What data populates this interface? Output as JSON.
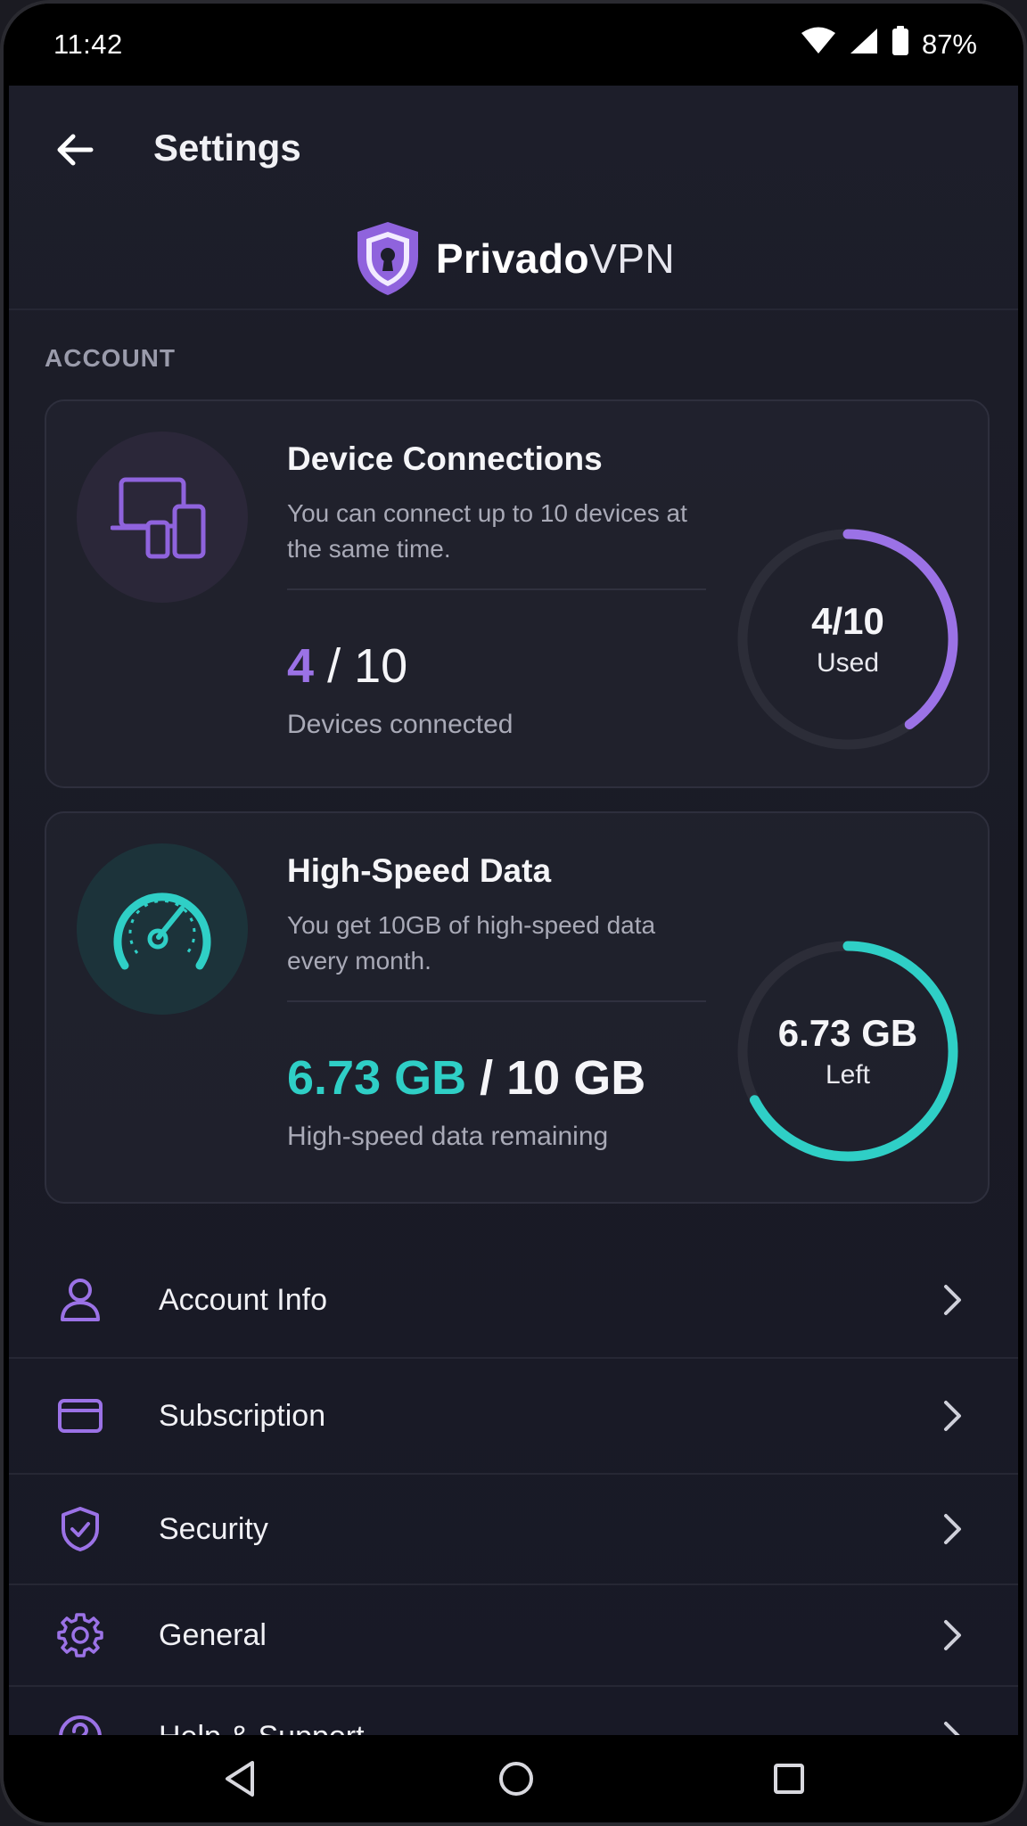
{
  "status_bar": {
    "time": "11:42",
    "battery": "87%"
  },
  "header": {
    "title": "Settings"
  },
  "brand": {
    "name_strong": "Privado",
    "name_light": "VPN"
  },
  "account": {
    "section_label": "ACCOUNT",
    "devices": {
      "title": "Device Connections",
      "description": "You can connect up to 10 devices at the same time.",
      "used": "4",
      "total_label": "/ 10",
      "caption": "Devices connected",
      "ring_main": "4/10",
      "ring_sub": "Used",
      "fraction_used": 0.4
    },
    "data": {
      "title": "High-Speed Data",
      "description": "You get 10GB of high-speed data every month.",
      "remaining": "6.73 GB",
      "total_label": "/ 10 GB",
      "caption": "High-speed data remaining",
      "ring_main": "6.73 GB",
      "ring_sub": "Left",
      "fraction_left": 0.673
    }
  },
  "menu": {
    "items": [
      {
        "label": "Account Info",
        "icon": "user-icon"
      },
      {
        "label": "Subscription",
        "icon": "credit-card-icon"
      },
      {
        "label": "Security",
        "icon": "shield-check-icon"
      },
      {
        "label": "General",
        "icon": "gear-icon"
      },
      {
        "label": "Help & Support",
        "icon": "help-circle-icon"
      }
    ]
  },
  "colors": {
    "accent_purple": "#9b72e6",
    "accent_teal": "#2fcfc6",
    "ring_track": "#2c2d38"
  }
}
